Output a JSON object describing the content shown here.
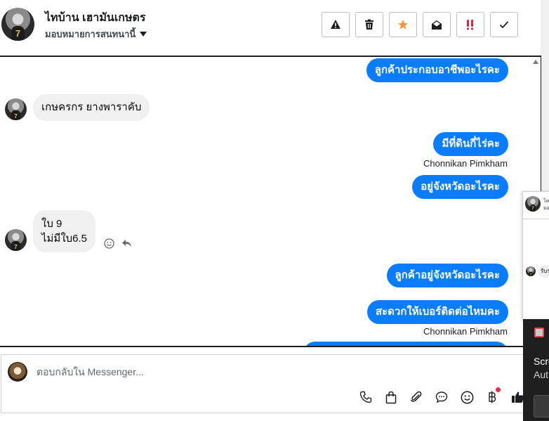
{
  "header": {
    "name": "ไทบ้าน เฮามันเกษตร",
    "subtitle": "มอบหมายการสนทนานี้",
    "toolbar": [
      "spam-icon",
      "delete-icon",
      "star-icon",
      "mark-unread-icon",
      "important-icon",
      "done-icon"
    ]
  },
  "conversation": {
    "messages": [
      {
        "type": "outgoing",
        "text": "ลูกค้าประกอบอาชีพอะไรคะ"
      },
      {
        "type": "incoming",
        "text": "เกษครกร  ยางพาราคับ"
      },
      {
        "type": "outgoing",
        "text": "มีที่ดินกี่ไร่คะ"
      },
      {
        "type": "sender",
        "text": "Chonnikan Pimkham"
      },
      {
        "type": "outgoing",
        "text": "อยู่จังหวัดอะไรคะ"
      },
      {
        "type": "incoming",
        "line1": "ใบ  9",
        "line2": "ไม่มีใบ6.5"
      },
      {
        "type": "outgoing",
        "text": "ลูกค้าอยู่จังหวัดอะไรคะ"
      },
      {
        "type": "outgoing",
        "text": "สะดวกให้เบอร์ติดต่อไหมคะ"
      },
      {
        "type": "sender",
        "text": "Chonnikan Pimkham"
      }
    ]
  },
  "composer": {
    "placeholder": "ตอบกลับใน Messenger..."
  },
  "side_panel": {
    "header_snippet": "ไท",
    "header_sub": "มอ",
    "bubble_snippet": "รับร"
  },
  "toast": {
    "title": "Scre",
    "subtitle": "Aut"
  },
  "colors": {
    "accent": "#0a7cff",
    "incoming_bubble": "#f0f0f0",
    "star": "#f7923a",
    "important": "#e41e3f"
  }
}
